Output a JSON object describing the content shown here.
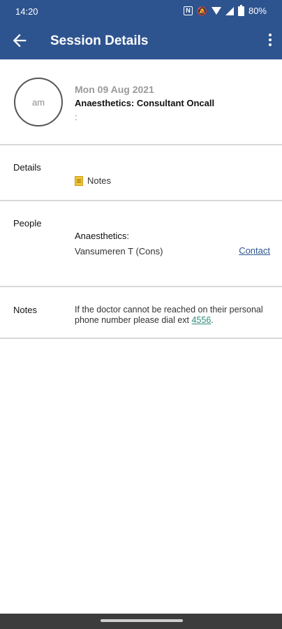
{
  "status_bar": {
    "time": "14:20",
    "icons": [
      "nfc-icon",
      "bell-muted-icon",
      "wifi-icon",
      "signal-icon",
      "battery-icon"
    ],
    "battery": "80%"
  },
  "app_bar": {
    "title": "Session Details",
    "back_icon": "arrow-left-icon",
    "menu_icon": "more-vert-icon"
  },
  "session": {
    "avatar_text": "am",
    "date": "Mon 09 Aug 2021",
    "name": "Anaesthetics: Consultant Oncall",
    "subtext": ":"
  },
  "details": {
    "label": "Details",
    "item_label": "Notes",
    "item_icon": "document-icon"
  },
  "people": {
    "label": "People",
    "group": "Anaesthetics:",
    "person": "Vansumeren T (Cons)",
    "contact_label": "Contact"
  },
  "notes": {
    "label": "Notes",
    "text_before": "If the doctor cannot be reached on their personal phone number please dial ext ",
    "ext": "4556",
    "text_after": "."
  },
  "colors": {
    "app_bar": "#2e548f",
    "link": "#2e548f",
    "ext_link": "#2e8a7a"
  }
}
